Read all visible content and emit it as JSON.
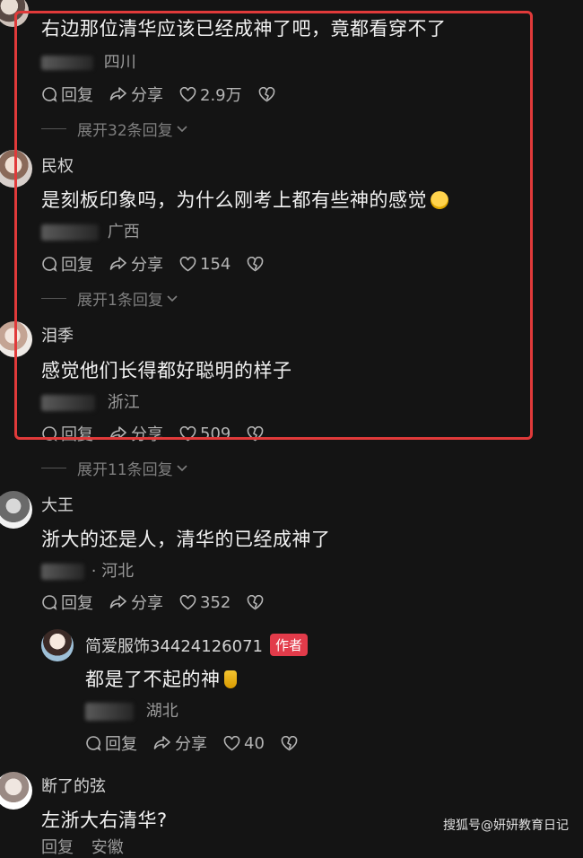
{
  "comments": [
    {
      "name": "",
      "content": "右边那位清华应该已经成神了吧，竟都看穿不了",
      "location": "四川",
      "reply_label": "回复",
      "share_label": "分享",
      "likes": "2.9万",
      "expand": "展开32条回复"
    },
    {
      "name": "民权",
      "content": "是刻板印象吗，为什么刚考上都有些神的感觉",
      "location": "广西",
      "reply_label": "回复",
      "share_label": "分享",
      "likes": "154",
      "expand": "展开1条回复"
    },
    {
      "name": "泪季",
      "content": "感觉他们长得都好聪明的样子",
      "location": "浙江",
      "reply_label": "回复",
      "share_label": "分享",
      "likes": "509",
      "expand": "展开11条回复"
    },
    {
      "name": "大王",
      "content": "浙大的还是人，清华的已经成神了",
      "location": "· 河北",
      "reply_label": "回复",
      "share_label": "分享",
      "likes": "352"
    },
    {
      "name": "简爱服饰34424126071",
      "author_tag": "作者",
      "content": "都是了不起的神",
      "location": "湖北",
      "reply_label": "回复",
      "share_label": "分享",
      "likes": "40"
    },
    {
      "name": "断了的弦",
      "content": "左浙大右清华?",
      "location": "安徽",
      "reply_label": "回复"
    }
  ],
  "watermark": "搜狐号@妍妍教育日记",
  "colors": {
    "background": "#141414",
    "highlight_border": "#e03a3a",
    "author_tag": "#e23b4a"
  }
}
